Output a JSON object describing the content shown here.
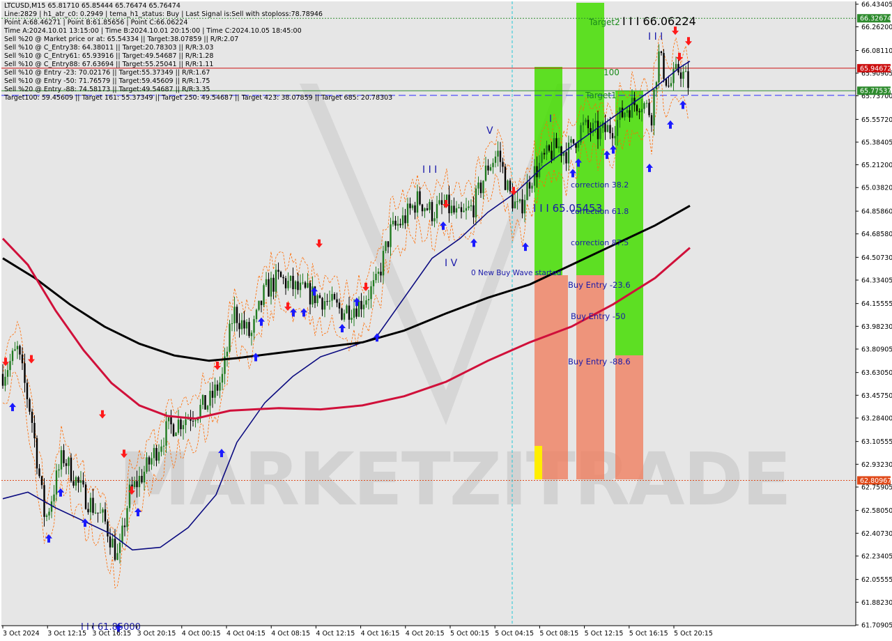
{
  "chart_data": {
    "type": "candlestick",
    "symbol": "LTCUSD,M15",
    "ohlc": {
      "open": "65.81710",
      "high": "65.85444",
      "low": "65.76474",
      "close": "65.76474"
    },
    "info_lines": [
      "LTCUSD,M15  65.81710 65.85444 65.76474 65.76474",
      "Line:2829 | h1_atr_c0: 0.2949 | tema_h1_status: Buy | Last Signal is:Sell with stoploss:78.78946",
      "Point A:68.46271 | Point B:61.85656 | Point C:66.06224",
      "Time A:2024.10.01 13:15:00 | Time B:2024.10.01 20:15:00 | Time C:2024.10.05 18:45:00",
      "Sell %20 @ Market price or at: 65.54334 || Target:38.07859 || R/R:2.07",
      "Sell %10 @ C_Entry38: 64.38011 || Target:20.78303 || R/R:3.03",
      "Sell %10 @ C_Entry61: 65.93916 || Target:49.54687 || R/R:1.28",
      "Sell %10 @ C_Entry88: 67.63694 || Target:55.25041 || R/R:1.11",
      "Sell %10 @ Entry -23: 70.02176 || Target:55.37349 || R/R:1.67",
      "Sell %10 @ Entry -50: 71.76579 || Target:59.45609 || R/R:1.75",
      "Sell %20 @ Entry -88: 74.58173 || Target:49.54687 || R/R:3.35",
      "Target100: 59.45609 || Target 161: 55.37349 || Target 250: 49.54687 || Target 423: 38.07859 || Target 685: 20.78303"
    ],
    "y_ticks": [
      "66.43405",
      "66.26200",
      "66.08110",
      "65.90905",
      "65.73700",
      "65.55720",
      "65.38405",
      "65.21200",
      "65.03820",
      "64.85860",
      "64.68580",
      "64.50730",
      "64.33405",
      "64.15555",
      "63.98230",
      "63.80905",
      "63.63050",
      "63.45750",
      "63.28400",
      "63.10555",
      "62.93230",
      "62.75905",
      "62.58050",
      "62.40730",
      "62.23405",
      "62.05555",
      "61.88230",
      "61.70905"
    ],
    "ylim": [
      61.70905,
      66.43405
    ],
    "x_ticks": [
      "3 Oct 2024",
      "3 Oct 12:15",
      "3 Oct 16:15",
      "3 Oct 20:15",
      "4 Oct 00:15",
      "4 Oct 04:15",
      "4 Oct 08:15",
      "4 Oct 12:15",
      "4 Oct 16:15",
      "4 Oct 20:15",
      "5 Oct 00:15",
      "5 Oct 04:15",
      "5 Oct 08:15",
      "5 Oct 12:15",
      "5 Oct 16:15",
      "5 Oct 20:15"
    ],
    "price_tags": [
      {
        "value": 66.32674,
        "label": "66.32674",
        "color": "#2e8b2e"
      },
      {
        "value": 65.94672,
        "label": "65.94672",
        "color": "#cc1111"
      },
      {
        "value": 65.77537,
        "label": "65.77537",
        "color": "#2e8b2e"
      },
      {
        "value": 62.80967,
        "label": "62.80967",
        "color": "#e04a1a"
      }
    ],
    "horizontal_lines": [
      {
        "value": 66.32674,
        "color": "#2e8b2e",
        "style": "dotted"
      },
      {
        "value": 65.94672,
        "color": "#cc1111",
        "style": "solid"
      },
      {
        "value": 65.77537,
        "color": "#2e8b2e",
        "style": "solid"
      },
      {
        "value": 65.74,
        "color": "#2a2aff",
        "style": "dashed"
      },
      {
        "value": 62.80967,
        "color": "#e04a1a",
        "style": "dotted"
      }
    ],
    "annotations": [
      {
        "text": "Target2",
        "color": "#1a8a1a"
      },
      {
        "text": "100",
        "color": "#1a8a1a"
      },
      {
        "text": "Target1",
        "color": "#1a8a1a"
      },
      {
        "text": "I I I 66.06224",
        "color": "#000000"
      },
      {
        "text": "I I I",
        "color": "#1a1aaa"
      },
      {
        "text": "I I I",
        "color": "#1a1aaa"
      },
      {
        "text": "V",
        "color": "#1a1aaa"
      },
      {
        "text": "I",
        "color": "#1a1aaa"
      },
      {
        "text": "I V",
        "color": "#1a1aaa"
      },
      {
        "text": "I I I 65.05453",
        "color": "#1a1aaa"
      },
      {
        "text": "correction 38.2",
        "color": "#1a1aaa"
      },
      {
        "text": "correction 61.8",
        "color": "#1a1aaa"
      },
      {
        "text": "correction 87.5",
        "color": "#1a1aaa"
      },
      {
        "text": "0 New Buy Wave started",
        "color": "#1a1aaa"
      },
      {
        "text": "Buy Entry -23.6",
        "color": "#1a1aaa"
      },
      {
        "text": "Buy Entry -50",
        "color": "#1a1aaa"
      },
      {
        "text": "Buy Entry -88.6",
        "color": "#1a1aaa"
      },
      {
        "text": "I I I 61.85000",
        "color": "#1a1aaa"
      }
    ],
    "watermark": "MARKETZITRADE",
    "colors": {
      "bull_candle": "#1f7a1f",
      "bear_candle": "#000000",
      "ma_blue": "#0b0b80",
      "ma_black": "#000000",
      "ma_red": "#d0103a",
      "envelope": "#ff6a00",
      "green_zone": "#44dd00",
      "salmon_zone": "#f08060",
      "up_arrow": "#1a1aff",
      "down_arrow": "#ff1a1a"
    }
  }
}
